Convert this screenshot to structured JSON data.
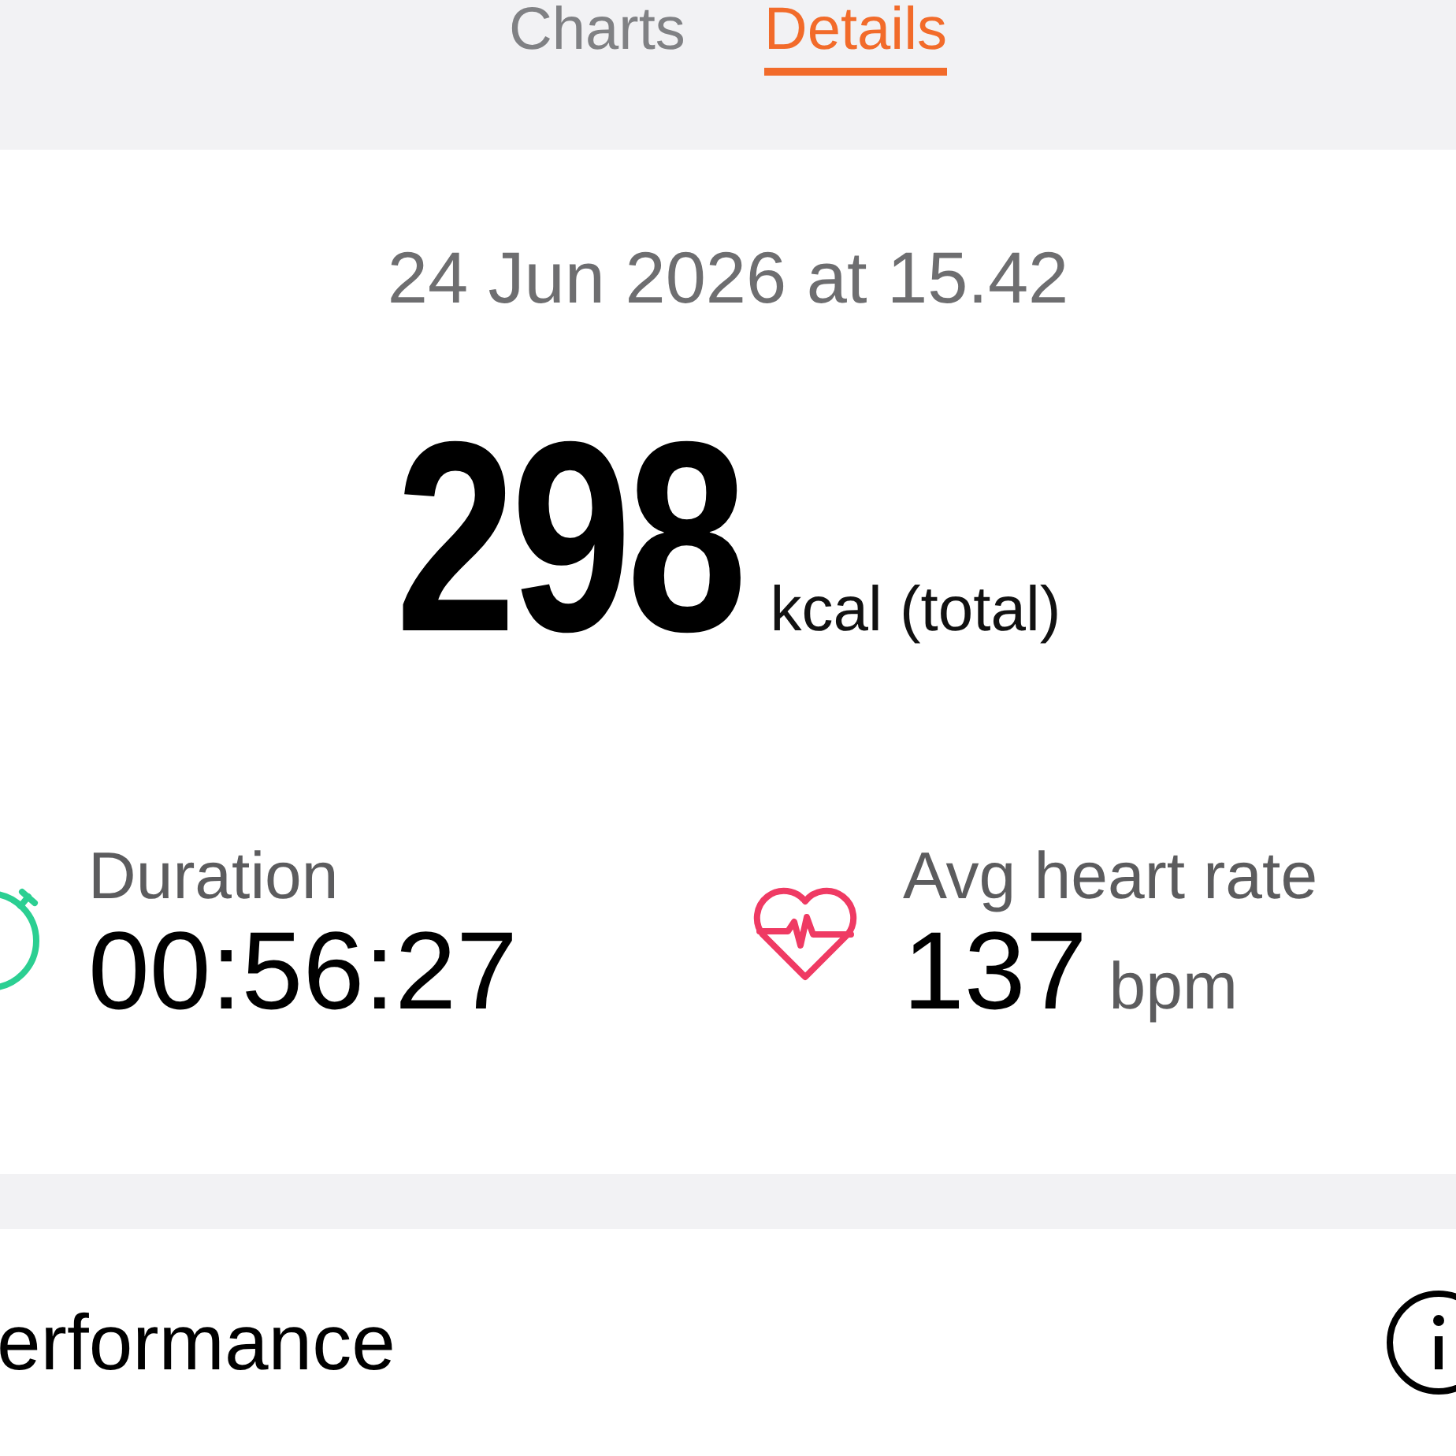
{
  "tabs": [
    {
      "label": "Charts",
      "selected": false
    },
    {
      "label": "Details",
      "selected": true
    }
  ],
  "summary": {
    "datetime": "24 Jun 2026 at 15.42",
    "calories": "298",
    "calories_unit": "kcal (total)"
  },
  "stats": [
    {
      "kind": "duration",
      "label": "Duration",
      "value": "00:56:27"
    },
    {
      "kind": "heart_rate",
      "label": "Avg heart rate",
      "value": "137",
      "unit": "bpm"
    }
  ],
  "section": {
    "title": "erformance"
  }
}
